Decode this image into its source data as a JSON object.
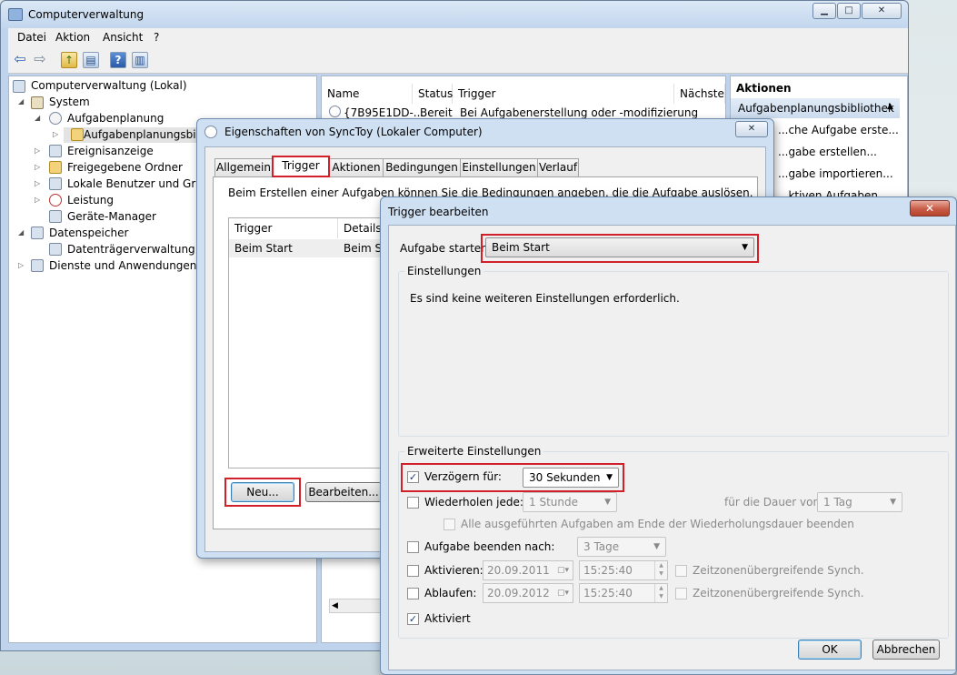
{
  "main_window": {
    "title": "Computerverwaltung",
    "menu": [
      "Datei",
      "Aktion",
      "Ansicht",
      "?"
    ],
    "tree": [
      {
        "label": "Computerverwaltung (Lokal)"
      },
      {
        "label": "System"
      },
      {
        "label": "Aufgabenplanung"
      },
      {
        "label": "Aufgabenplanungsbibli"
      },
      {
        "label": "Ereignisanzeige"
      },
      {
        "label": "Freigegebene Ordner"
      },
      {
        "label": "Lokale Benutzer und Grupp"
      },
      {
        "label": "Leistung"
      },
      {
        "label": "Geräte-Manager"
      },
      {
        "label": "Datenspeicher"
      },
      {
        "label": "Datenträgerverwaltung"
      },
      {
        "label": "Dienste und Anwendungen"
      }
    ],
    "list": {
      "columns": [
        "Name",
        "Status",
        "Trigger",
        "Nächste"
      ],
      "rows": [
        {
          "name": "{7B95E1DD-...",
          "status": "Bereit",
          "trigger": "Bei Aufgabenerstellung oder -modifizierung"
        }
      ]
    },
    "actions": {
      "header": "Aktionen",
      "section": "Aufgabenplanungsbibliothek",
      "items": [
        "...che Aufgabe erste...",
        "...gabe erstellen...",
        "...gabe importieren...",
        "...ktiven Aufgaben ..."
      ]
    }
  },
  "props_dialog": {
    "title": "Eigenschaften von SyncToy (Lokaler Computer)",
    "tabs": [
      "Allgemein",
      "Trigger",
      "Aktionen",
      "Bedingungen",
      "Einstellungen",
      "Verlauf"
    ],
    "description": "Beim Erstellen einer Aufgaben können Sie die Bedingungen angeben, die die Aufgabe auslösen.",
    "table": {
      "columns": [
        "Trigger",
        "Details"
      ],
      "rows": [
        {
          "trigger": "Beim Start",
          "details": "Beim Sy"
        }
      ]
    },
    "buttons": {
      "new": "Neu...",
      "edit": "Bearbeiten..."
    }
  },
  "trigger_dialog": {
    "title": "Trigger bearbeiten",
    "start_label": "Aufgabe starten:",
    "start_value": "Beim Start",
    "settings_group": "Einstellungen",
    "settings_text": "Es sind keine weiteren Einstellungen erforderlich.",
    "advanced_group": "Erweiterte Einstellungen",
    "delay": {
      "label": "Verzögern für:",
      "checked": true,
      "value": "30 Sekunden"
    },
    "repeat": {
      "label": "Wiederholen jede:",
      "checked": false,
      "value": "1 Stunde",
      "duration_label": "für die Dauer von:",
      "duration_value": "1 Tag",
      "stop_all_label": "Alle ausgeführten Aufgaben am Ende der Wiederholungsdauer beenden"
    },
    "end_task": {
      "label": "Aufgabe beenden nach:",
      "checked": false,
      "value": "3 Tage"
    },
    "activate": {
      "label": "Aktivieren:",
      "checked": false,
      "date": "20.09.2011",
      "time": "15:25:40",
      "sync_label": "Zeitzonenübergreifende Synch."
    },
    "expire": {
      "label": "Ablaufen:",
      "checked": false,
      "date": "20.09.2012",
      "time": "15:25:40",
      "sync_label": "Zeitzonenübergreifende Synch."
    },
    "enabled": {
      "label": "Aktiviert",
      "checked": true
    },
    "buttons": {
      "ok": "OK",
      "cancel": "Abbrechen"
    }
  },
  "colors": {
    "highlight_red": "#d2202a",
    "window_frame": "#cfe0f3",
    "dialog_face": "#f0f0f0"
  }
}
